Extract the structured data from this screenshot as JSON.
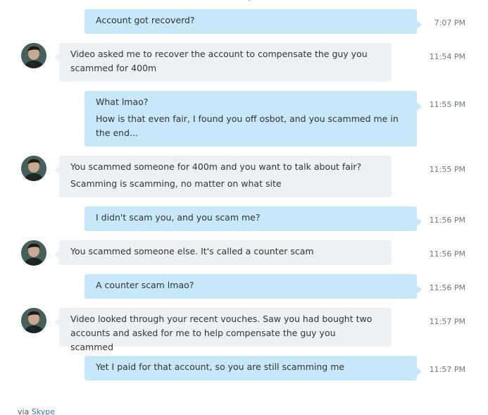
{
  "conversation": {
    "top_fragment": "›",
    "messages": [
      {
        "sender": "me",
        "lines": [
          "Account got recoverd?"
        ],
        "time": "7:07 PM"
      },
      {
        "sender": "them",
        "lines": [
          "Video asked me to recover the account to compensate the guy you scammed for 400m"
        ],
        "time": "11:54 PM"
      },
      {
        "sender": "me",
        "lines": [
          "What lmao?",
          "How is that even fair, I found you off osbot, and you scammed me in the end..."
        ],
        "time": "11:55 PM"
      },
      {
        "sender": "them",
        "lines": [
          "You scammed someone for 400m and you want to talk about fair?",
          "Scamming is scamming, no matter on what site"
        ],
        "time": "11:55 PM"
      },
      {
        "sender": "me",
        "lines": [
          "I didn't scam you, and you scam me?"
        ],
        "time": "11:56 PM"
      },
      {
        "sender": "them",
        "lines": [
          "You scammed someone else. It's called a counter scam"
        ],
        "time": "11:56 PM"
      },
      {
        "sender": "me",
        "lines": [
          "A counter scam lmao?"
        ],
        "time": "11:56 PM"
      },
      {
        "sender": "them",
        "lines": [
          "Video looked through your recent vouches. Saw you had bought two accounts and asked for me to help compensate the guy you scammed"
        ],
        "time": "11:57 PM"
      },
      {
        "sender": "me",
        "lines": [
          "Yet I paid for that account, so you are still scamming me"
        ],
        "time": "11:57 PM"
      }
    ]
  },
  "footer": {
    "via_label": "via",
    "link_label": "Skype"
  },
  "colors": {
    "outgoing_bubble": "#c7e8f8",
    "incoming_bubble": "#eef1f4",
    "timestamp": "#6f7780",
    "link": "#2a7ab8"
  },
  "icons": {
    "contact_avatar": "avatar-icon"
  }
}
